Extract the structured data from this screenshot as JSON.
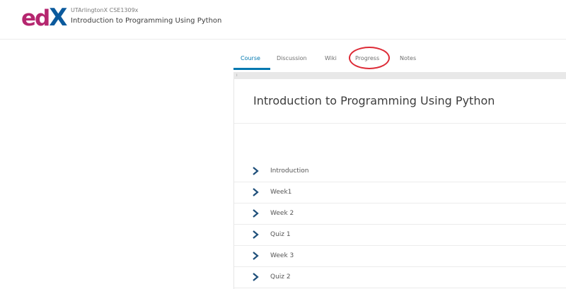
{
  "header": {
    "logo_left": "ed",
    "logo_right": "X",
    "org": "UTArlingtonX CSE1309x",
    "title": "Introduction to Programming Using Python"
  },
  "tabs": [
    {
      "label": "Course",
      "active": true
    },
    {
      "label": "Discussion",
      "active": false
    },
    {
      "label": "Wiki",
      "active": false
    },
    {
      "label": "Progress",
      "active": false,
      "highlighted": true
    },
    {
      "label": "Notes",
      "active": false
    }
  ],
  "gray_bar_mark": "ı",
  "main": {
    "title": "Introduction to Programming Using Python"
  },
  "outline": [
    {
      "label": "Introduction"
    },
    {
      "label": "Week1"
    },
    {
      "label": "Week 2"
    },
    {
      "label": "Quiz 1"
    },
    {
      "label": "Week 3"
    },
    {
      "label": "Quiz 2"
    }
  ],
  "colors": {
    "brand_pink": "#b5266f",
    "brand_blue": "#0b5a9d",
    "accent": "#0078b0",
    "highlight_ring": "#dd2a36"
  }
}
